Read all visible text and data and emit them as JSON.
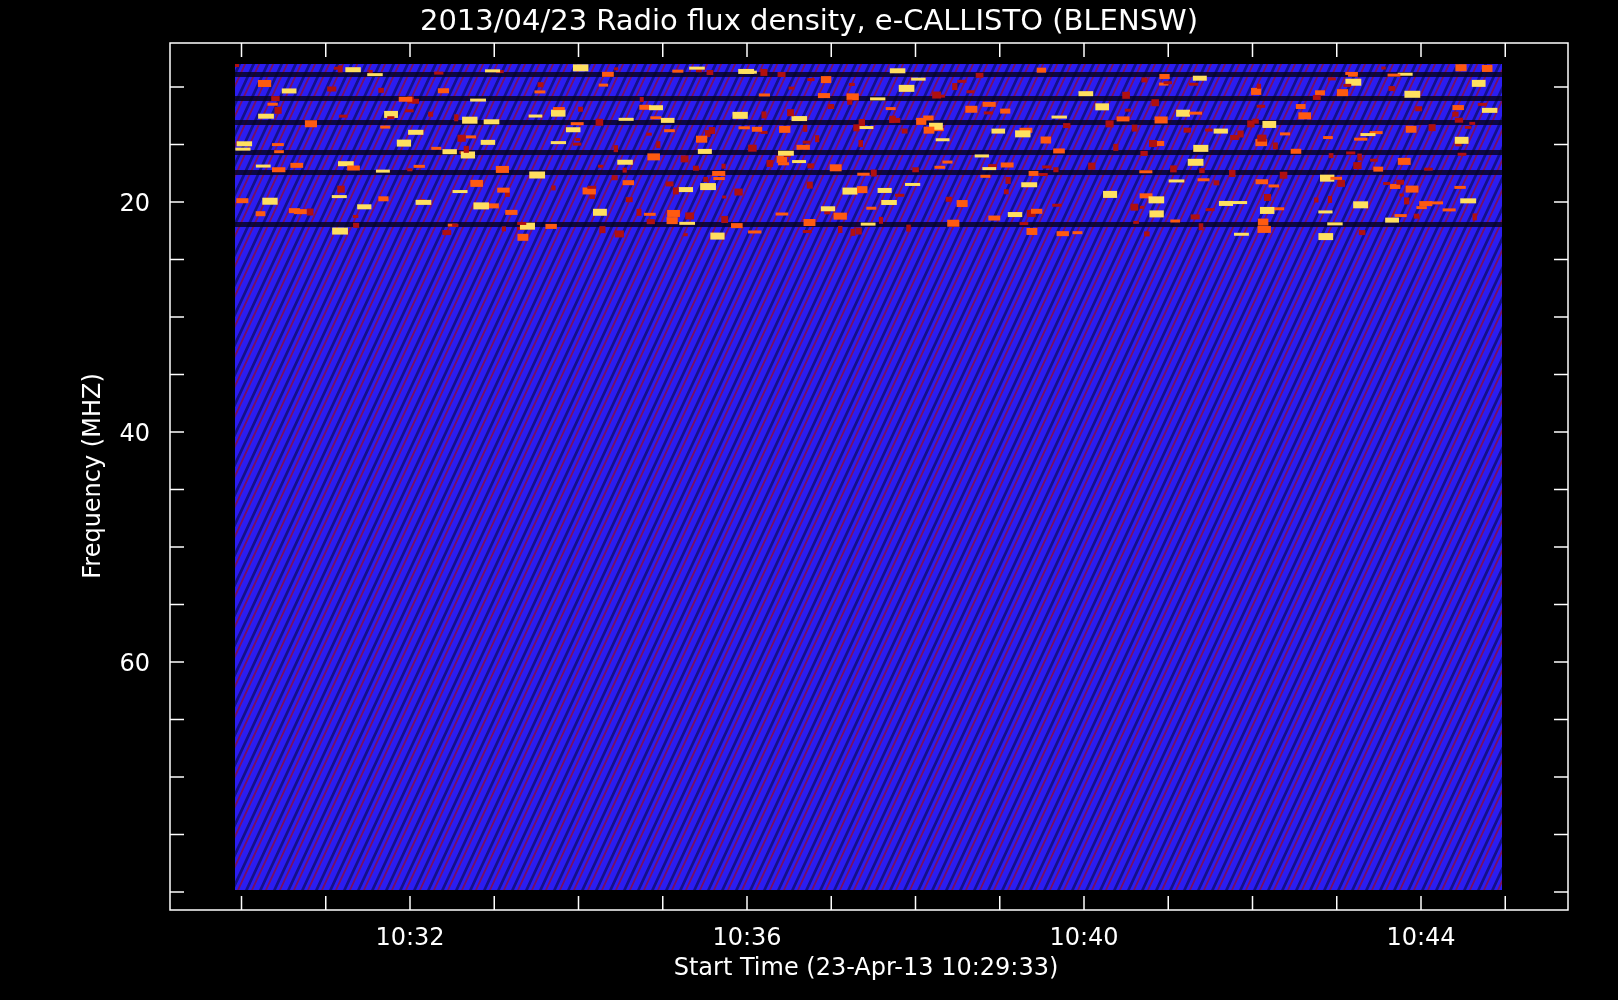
{
  "title": "2013/04/23  Radio flux density, e-CALLISTO (BLENSW)",
  "y_axis": {
    "label": "Frequency (MHZ)",
    "ticks": [
      "20",
      "40",
      "60"
    ]
  },
  "x_axis": {
    "label": "Start Time (23-Apr-13 10:29:33)",
    "ticks": [
      "10:32",
      "10:36",
      "10:40",
      "10:44"
    ]
  }
}
